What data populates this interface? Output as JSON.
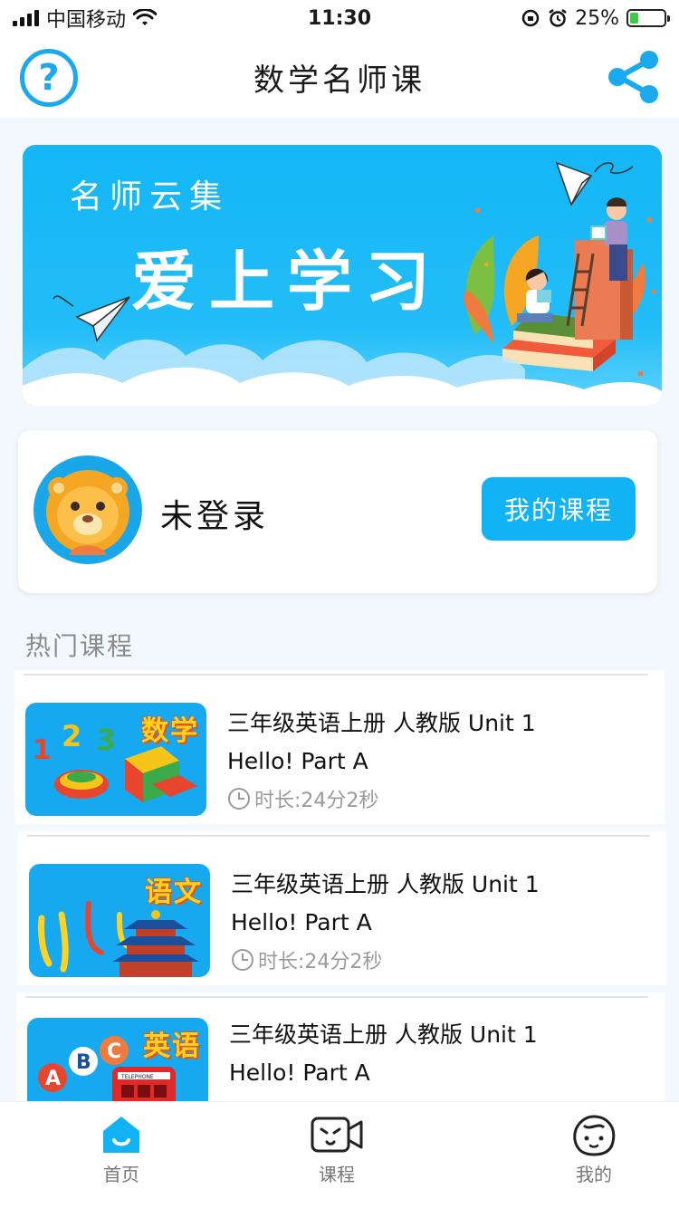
{
  "status_bar": {
    "carrier": "中国移动",
    "time": "11:30",
    "battery": "25%",
    "battery_level": 0.25
  },
  "header": {
    "title": "数学名师课",
    "help_icon": "question-circle-icon",
    "share_icon": "share-icon"
  },
  "banner": {
    "subtitle": "名师云集",
    "headline": "爱上学习"
  },
  "user_card": {
    "login_status": "未登录",
    "my_courses_label": "我的课程"
  },
  "section": {
    "title": "热门课程"
  },
  "courses": [
    {
      "tag": "数学",
      "title_line1": "三年级英语上册 人教版 Unit 1",
      "title_line2": "Hello! Part A",
      "duration": "时长:24分2秒"
    },
    {
      "tag": "语文",
      "title_line1": "三年级英语上册 人教版 Unit 1",
      "title_line2": "Hello! Part A",
      "duration": "时长:24分2秒"
    },
    {
      "tag": "英语",
      "title_line1": "三年级英语上册 人教版 Unit 1",
      "title_line2": "Hello! Part A",
      "duration": ""
    }
  ],
  "thumb_art": {
    "math_digits": [
      "1",
      "2",
      "3"
    ],
    "english_letters": [
      "A",
      "B",
      "C"
    ],
    "phone_booth_sign": "TELEPHONE"
  },
  "tab_bar": {
    "tabs": [
      {
        "label": "首页",
        "icon": "home-icon",
        "active": true
      },
      {
        "label": "课程",
        "icon": "video-camera-icon",
        "active": false
      },
      {
        "label": "我的",
        "icon": "face-icon",
        "active": false
      }
    ]
  },
  "colors": {
    "accent": "#12b3f4",
    "section_title": "#8b8b8b"
  }
}
